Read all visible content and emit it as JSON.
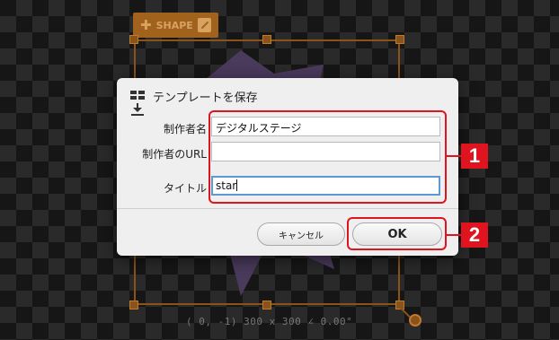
{
  "toolbar": {
    "shape_label": "SHAPE"
  },
  "readout": "(   0,  -1)  300 x 300 ∠   0.00°",
  "dialog": {
    "title": "テンプレートを保存",
    "fields": [
      {
        "label": "制作者名",
        "value": "デジタルステージ"
      },
      {
        "label": "制作者のURL",
        "value": ""
      },
      {
        "label": "タイトル",
        "value": "star"
      }
    ],
    "cancel_label": "キャンセル",
    "ok_label": "OK"
  },
  "callouts": [
    {
      "number": "1"
    },
    {
      "number": "2"
    }
  ],
  "colors": {
    "accent": "#e0141e",
    "frame": "#8a531a",
    "star": "#4a3a5c",
    "focus": "#5b9bd5"
  }
}
